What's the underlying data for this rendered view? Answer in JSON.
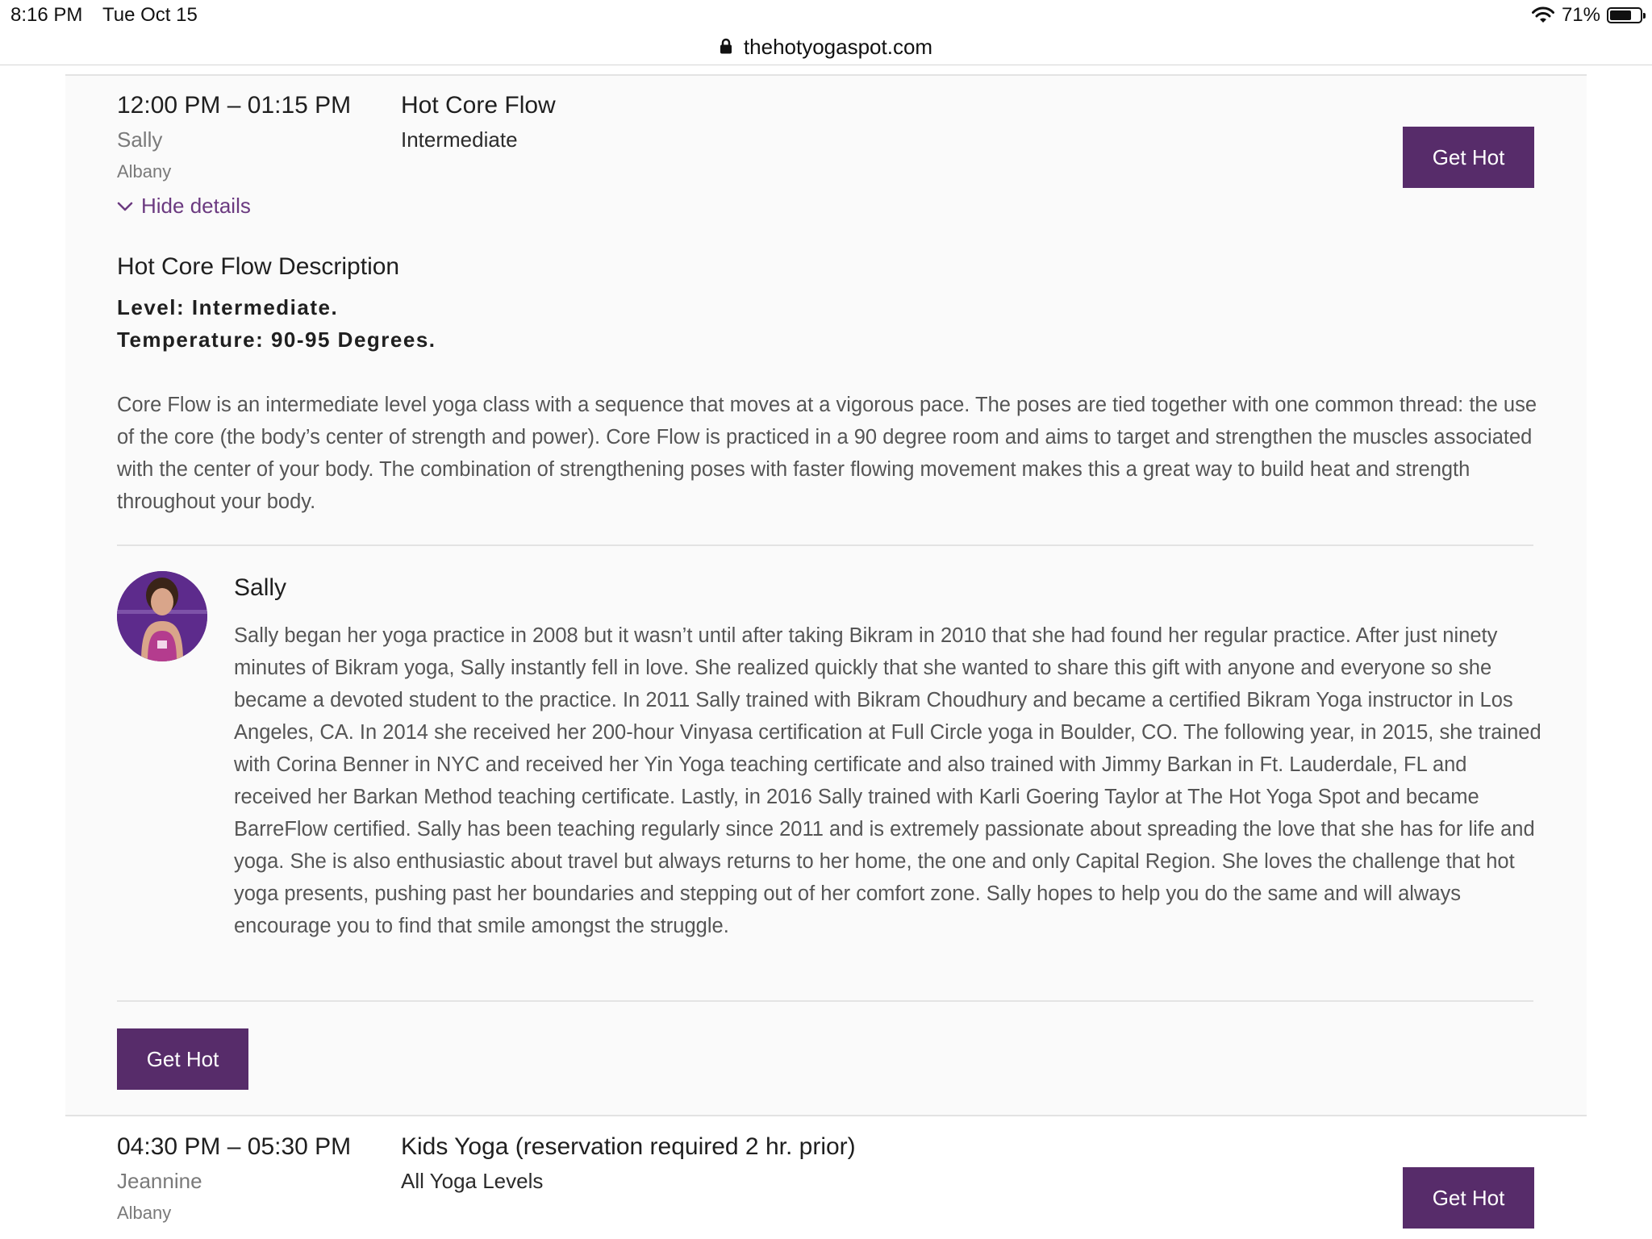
{
  "status_bar": {
    "time": "8:16 PM",
    "date": "Tue Oct 15",
    "battery": "71%",
    "battery_level": 0.71
  },
  "browser": {
    "url": "thehotyogaspot.com"
  },
  "class1": {
    "time": "12:00 PM – 01:15 PM",
    "instructor": "Sally",
    "location": "Albany",
    "title": "Hot Core Flow",
    "level": "Intermediate",
    "button_label": "Get Hot",
    "toggle_label": "Hide details",
    "description": {
      "title": "Hot Core Flow Description",
      "level_line": "Level: Intermediate.",
      "temperature_line": "Temperature: 90-95 Degrees.",
      "body": "Core Flow is an intermediate level yoga class with a sequence that moves at a vigorous pace. The poses are tied together with one common thread: the use of the core (the body’s center of strength and power). Core Flow is practiced in a 90 degree room and aims to target and strengthen the muscles associated with the center of your body. The combination of strengthening poses with faster flowing movement makes this a great way to build heat and strength throughout your body."
    },
    "instructor_bio": {
      "name": "Sally",
      "body": "Sally began her yoga practice in 2008 but it wasn’t until after taking Bikram in 2010 that she had found her regular practice. After just ninety minutes of Bikram yoga, Sally instantly fell in love. She realized quickly that she wanted to share this gift with anyone and everyone so she became a devoted student to the practice. In 2011 Sally trained with Bikram Choudhury and became a certified Bikram Yoga instructor in Los Angeles, CA. In 2014 she received her 200-hour Vinyasa certification at Full Circle yoga in Boulder, CO. The following year, in 2015, she trained with Corina Benner in NYC and received her Yin Yoga teaching certificate and also trained with Jimmy Barkan in Ft. Lauderdale, FL and received her Barkan Method teaching certificate. Lastly, in 2016 Sally trained with Karli Goering Taylor at The Hot Yoga Spot and became BarreFlow certified. Sally has been teaching regularly since 2011 and is extremely passionate about spreading the love that she has for life and yoga. She is also enthusiastic about travel but always returns to her home, the one and only Capital Region. She loves the challenge that hot yoga presents, pushing past her boundaries and stepping out of her comfort zone. Sally hopes to help you do the same and will always encourage you to find that smile amongst the struggle."
    },
    "bottom_button_label": "Get Hot"
  },
  "class2": {
    "time": "04:30 PM – 05:30 PM",
    "instructor": "Jeannine",
    "location": "Albany",
    "title": "Kids Yoga (reservation required 2 hr. prior)",
    "level": "All Yoga Levels",
    "button_label": "Get Hot"
  },
  "colors": {
    "accent": "#572c6a",
    "link": "#6b3a80"
  }
}
